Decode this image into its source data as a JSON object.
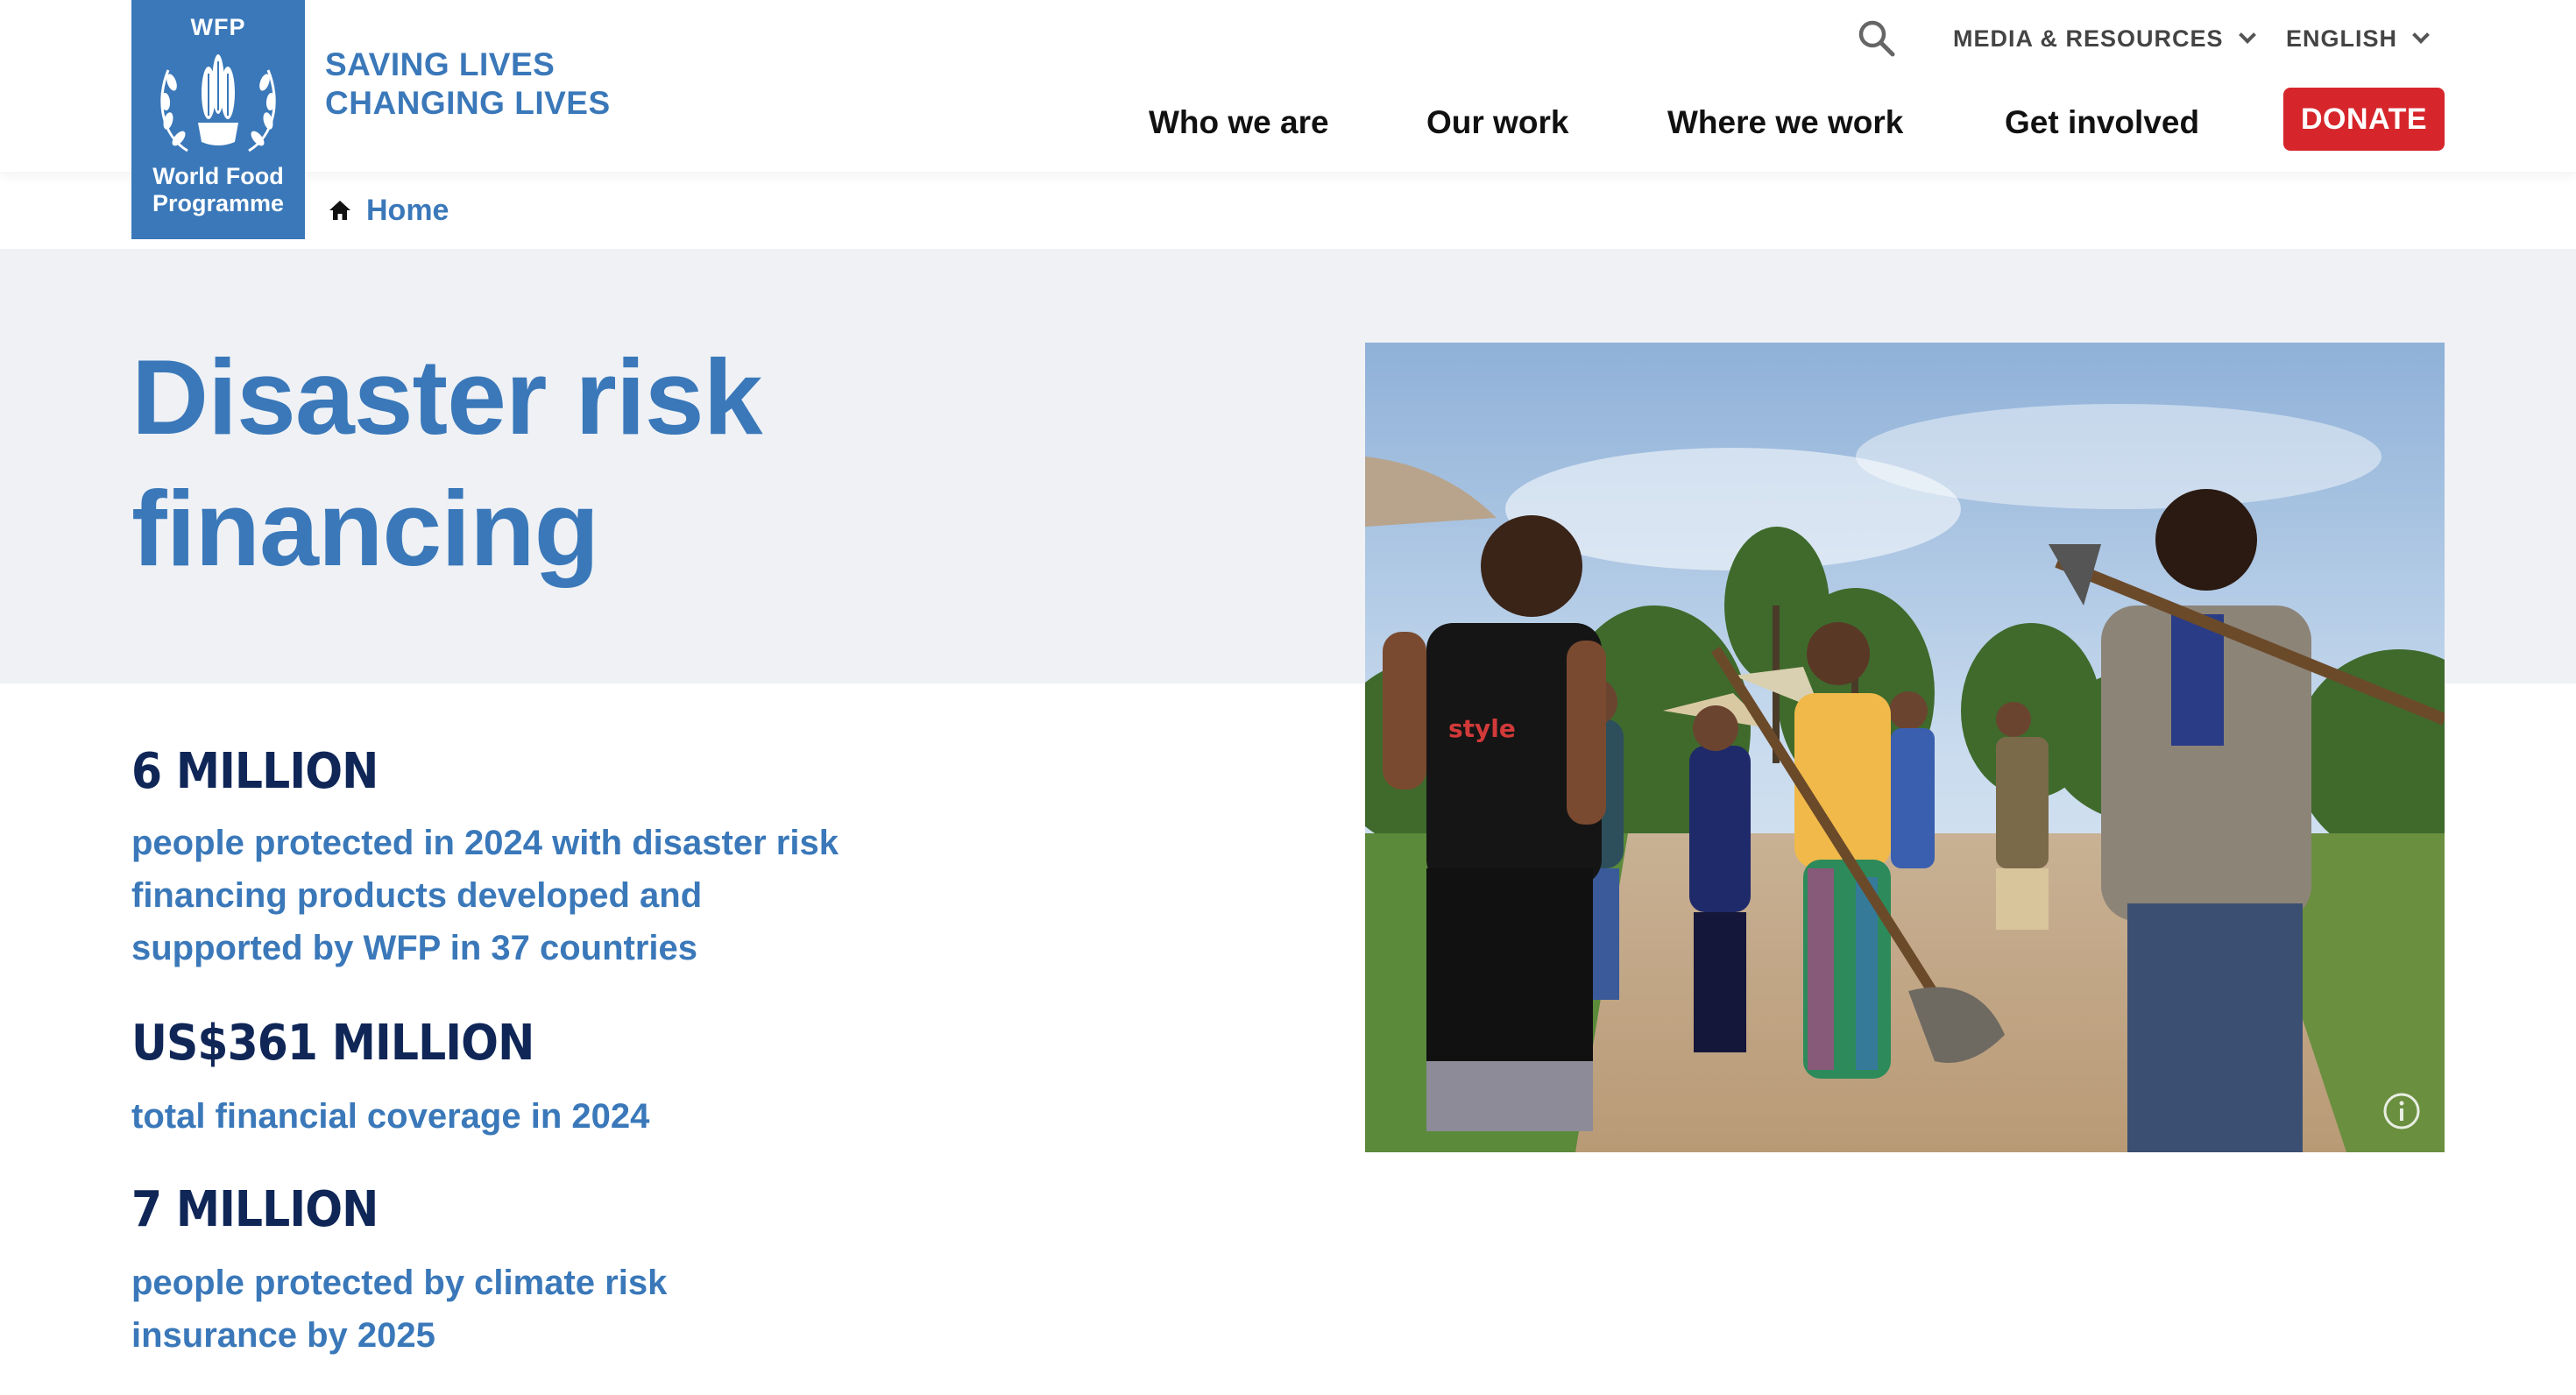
{
  "logo": {
    "acronym": "WFP",
    "name_line1": "World Food",
    "name_line2": "Programme",
    "brand_color": "#3a78b9"
  },
  "tagline": {
    "line1": "SAVING LIVES",
    "line2": "CHANGING LIVES"
  },
  "utility_nav": {
    "search_icon": "search-icon",
    "media_label": "MEDIA & RESOURCES",
    "language_label": "ENGLISH"
  },
  "main_nav": {
    "items": [
      "Who we are",
      "Our work",
      "Where we work",
      "Get involved"
    ],
    "donate_label": "DONATE",
    "donate_color": "#d6262b"
  },
  "breadcrumb": {
    "home_icon": "home-icon",
    "home_label": "Home"
  },
  "hero": {
    "title": "Disaster risk financing",
    "info_icon": "info-icon"
  },
  "stats": [
    {
      "number": "6 MILLION",
      "description": "people protected in 2024 with disaster risk financing products developed and supported by WFP in 37 countries"
    },
    {
      "number": "US$361 MILLION",
      "description": "total financial coverage in 2024"
    },
    {
      "number": "7 MILLION",
      "description": "people protected by climate risk insurance by 2025"
    }
  ]
}
